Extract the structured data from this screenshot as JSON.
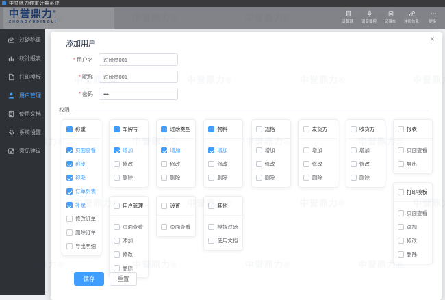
{
  "titlebar": {
    "title": "中誉鼎力称重计量系统"
  },
  "header": {
    "logo_text": "中誉鼎力",
    "logo_reg": "®",
    "logo_sub": "ZHONGYUDINGLI",
    "tools": [
      {
        "label": "计算器",
        "icon": "calculator-icon"
      },
      {
        "label": "语音播控",
        "icon": "microphone-icon"
      },
      {
        "label": "记事本",
        "icon": "notepad-icon"
      },
      {
        "label": "注册信息",
        "icon": "link-icon"
      },
      {
        "label": "更多",
        "icon": "more-icon"
      }
    ]
  },
  "sidebar": {
    "items": [
      {
        "label": "过磅称重",
        "icon": "scale-icon",
        "active": false
      },
      {
        "label": "统计报表",
        "icon": "bar-chart-icon",
        "active": false
      },
      {
        "label": "打印模板",
        "icon": "print-template-icon",
        "active": false
      },
      {
        "label": "用户管理",
        "icon": "user-icon",
        "active": true
      },
      {
        "label": "使用文档",
        "icon": "document-icon",
        "active": false
      },
      {
        "label": "系统设置",
        "icon": "gear-icon",
        "active": false
      },
      {
        "label": "意见建议",
        "icon": "edit-icon",
        "active": false
      }
    ]
  },
  "modal": {
    "title": "添加用户",
    "close": "×",
    "required_mark": "*",
    "fields": [
      {
        "label": "用户名",
        "required": true,
        "value": "过磅员001"
      },
      {
        "label": "昵称",
        "required": true,
        "value": "过磅员001"
      },
      {
        "label": "密码",
        "required": true,
        "value": "•••"
      }
    ],
    "permissions_label": "权限",
    "permission_columns": [
      {
        "cards": [
          {
            "title": "称重",
            "state": "indeterminate",
            "items": [
              {
                "label": "页面查看",
                "checked": true
              },
              {
                "label": "称皮",
                "checked": true
              },
              {
                "label": "称毛",
                "checked": true
              },
              {
                "label": "订单列表",
                "checked": true
              },
              {
                "label": "补录",
                "checked": true
              },
              {
                "label": "修改订单",
                "checked": false
              },
              {
                "label": "删除订单",
                "checked": false
              },
              {
                "label": "导出明细",
                "checked": false
              }
            ]
          }
        ]
      },
      {
        "cards": [
          {
            "title": "车牌号",
            "state": "indeterminate",
            "items": [
              {
                "label": "增加",
                "checked": true
              },
              {
                "label": "修改",
                "checked": false
              },
              {
                "label": "删除",
                "checked": false
              }
            ]
          },
          {
            "title": "用户管理",
            "state": "unchecked",
            "items": [
              {
                "label": "页面查看",
                "checked": false
              },
              {
                "label": "添加",
                "checked": false
              },
              {
                "label": "修改",
                "checked": false
              },
              {
                "label": "删除",
                "checked": false
              }
            ]
          }
        ]
      },
      {
        "cards": [
          {
            "title": "过磅类型",
            "state": "indeterminate",
            "items": [
              {
                "label": "增加",
                "checked": true
              },
              {
                "label": "修改",
                "checked": false
              },
              {
                "label": "删除",
                "checked": false
              }
            ]
          },
          {
            "title": "设置",
            "state": "unchecked",
            "items": [
              {
                "label": "页面查看",
                "checked": false
              }
            ]
          }
        ]
      },
      {
        "cards": [
          {
            "title": "物料",
            "state": "indeterminate",
            "items": [
              {
                "label": "增加",
                "checked": true
              },
              {
                "label": "修改",
                "checked": false
              },
              {
                "label": "删除",
                "checked": false
              }
            ]
          },
          {
            "title": "其他",
            "state": "unchecked",
            "items": [
              {
                "label": "模拟过磅",
                "checked": false
              },
              {
                "label": "使用文档",
                "checked": false
              }
            ]
          }
        ]
      },
      {
        "cards": [
          {
            "title": "规格",
            "state": "unchecked",
            "items": [
              {
                "label": "增加",
                "checked": false
              },
              {
                "label": "修改",
                "checked": false
              },
              {
                "label": "删除",
                "checked": false
              }
            ]
          }
        ]
      },
      {
        "cards": [
          {
            "title": "发货方",
            "state": "unchecked",
            "items": [
              {
                "label": "增加",
                "checked": false
              },
              {
                "label": "修改",
                "checked": false
              },
              {
                "label": "删除",
                "checked": false
              }
            ]
          }
        ]
      },
      {
        "cards": [
          {
            "title": "收货方",
            "state": "unchecked",
            "items": [
              {
                "label": "增加",
                "checked": false
              },
              {
                "label": "修改",
                "checked": false
              },
              {
                "label": "删除",
                "checked": false
              }
            ]
          }
        ]
      },
      {
        "cards": [
          {
            "title": "报表",
            "state": "unchecked",
            "items": [
              {
                "label": "页面查看",
                "checked": false
              },
              {
                "label": "导出",
                "checked": false
              }
            ]
          },
          {
            "title": "打印模板",
            "state": "unchecked",
            "items": [
              {
                "label": "页面查看",
                "checked": false
              },
              {
                "label": "添加",
                "checked": false
              },
              {
                "label": "修改",
                "checked": false
              },
              {
                "label": "删除",
                "checked": false
              }
            ]
          }
        ]
      }
    ],
    "buttons": {
      "save": "保存",
      "reset": "重置"
    }
  },
  "watermark": "中誉鼎力®",
  "colors": {
    "primary": "#409EFF",
    "titlebar_bg": "#3a3a3c",
    "header_bg": "#828388",
    "sidebar_bg": "#2e3237",
    "logo": "#1c3a6b",
    "required": "#F56C6C"
  }
}
